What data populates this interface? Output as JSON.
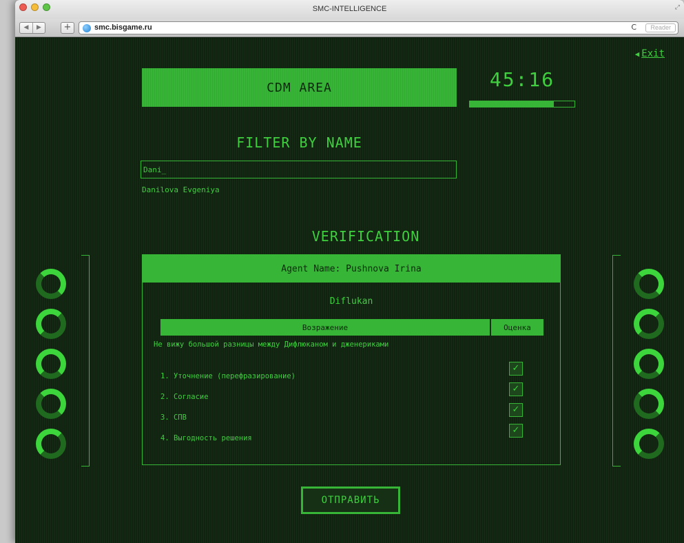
{
  "window": {
    "title": "SMC-INTELLIGENCE",
    "url": "smc.bisgame.ru",
    "reader_label": "Reader"
  },
  "page": {
    "exit_label": "Exit",
    "area_title": "CDM AREA",
    "timer": "45:16",
    "timer_progress": 0.8,
    "filter": {
      "title": "FILTER BY NAME",
      "value": "Dani_",
      "suggestion": "Danilova Evgeniya"
    },
    "verification": {
      "title": "VERIFICATION",
      "agent": "Agent Name: Pushnova Irina",
      "drug": "Diflukan",
      "col_objection": "Возражение",
      "col_score": "Оценка",
      "objection": "Не вижу большой разницы между Дифлюканом и дженериками",
      "steps": [
        {
          "label": "1. Уточнение (перефразирование)",
          "checked": true
        },
        {
          "label": "2. Согласие",
          "checked": true
        },
        {
          "label": "3. СПВ",
          "checked": true
        },
        {
          "label": "4. Выгодность решения",
          "checked": true
        }
      ]
    },
    "submit_label": "ОТПРАВИТЬ",
    "colors": {
      "accent": "#37b537",
      "background": "#112211",
      "text": "#3fcf3f"
    }
  }
}
